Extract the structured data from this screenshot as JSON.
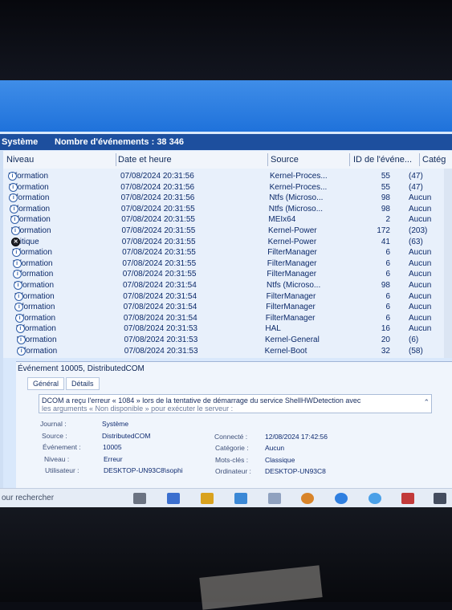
{
  "header": {
    "title": "Système",
    "event_count": "Nombre d'événements : 38 346"
  },
  "columns": {
    "niveau": "Niveau",
    "date": "Date et heure",
    "source": "Source",
    "id": "ID de l'événe...",
    "category": "Catég"
  },
  "rows": [
    {
      "level": "Information",
      "date": "07/08/2024 20:31:56",
      "source": "Kernel-Proces...",
      "id": "55",
      "category": "(47)"
    },
    {
      "level": "Information",
      "date": "07/08/2024 20:31:56",
      "source": "Kernel-Proces...",
      "id": "55",
      "category": "(47)"
    },
    {
      "level": "Information",
      "date": "07/08/2024 20:31:56",
      "source": "Ntfs (Microso...",
      "id": "98",
      "category": "Aucun"
    },
    {
      "level": "Information",
      "date": "07/08/2024 20:31:55",
      "source": "Ntfs (Microso...",
      "id": "98",
      "category": "Aucun"
    },
    {
      "level": "Information",
      "date": "07/08/2024 20:31:55",
      "source": "MEIx64",
      "id": "2",
      "category": "Aucun"
    },
    {
      "level": "Information",
      "date": "07/08/2024 20:31:55",
      "source": "Kernel-Power",
      "id": "172",
      "category": "(203)"
    },
    {
      "level": "Critique",
      "date": "07/08/2024 20:31:55",
      "source": "Kernel-Power",
      "id": "41",
      "category": "(63)"
    },
    {
      "level": "Information",
      "date": "07/08/2024 20:31:55",
      "source": "FilterManager",
      "id": "6",
      "category": "Aucun"
    },
    {
      "level": "Information",
      "date": "07/08/2024 20:31:55",
      "source": "FilterManager",
      "id": "6",
      "category": "Aucun"
    },
    {
      "level": "Information",
      "date": "07/08/2024 20:31:55",
      "source": "FilterManager",
      "id": "6",
      "category": "Aucun"
    },
    {
      "level": "Information",
      "date": "07/08/2024 20:31:54",
      "source": "Ntfs (Microso...",
      "id": "98",
      "category": "Aucun"
    },
    {
      "level": "Information",
      "date": "07/08/2024 20:31:54",
      "source": "FilterManager",
      "id": "6",
      "category": "Aucun"
    },
    {
      "level": "Information",
      "date": "07/08/2024 20:31:54",
      "source": "FilterManager",
      "id": "6",
      "category": "Aucun"
    },
    {
      "level": "Information",
      "date": "07/08/2024 20:31:54",
      "source": "FilterManager",
      "id": "6",
      "category": "Aucun"
    },
    {
      "level": "Information",
      "date": "07/08/2024 20:31:53",
      "source": "HAL",
      "id": "16",
      "category": "Aucun"
    },
    {
      "level": "Information",
      "date": "07/08/2024 20:31:53",
      "source": "Kernel-General",
      "id": "20",
      "category": "(6)"
    },
    {
      "level": "Information",
      "date": "07/08/2024 20:31:53",
      "source": "Kernel-Boot",
      "id": "32",
      "category": "(58)"
    }
  ],
  "detail": {
    "title": "Événement 10005, DistributedCOM",
    "tab_general": "Général",
    "tab_details": "Détails",
    "message_line1": "DCOM a reçu l'erreur « 1084 » lors de la tentative de démarrage du service ShellHWDetection avec",
    "message_line2": "les arguments « Non disponible » pour exécuter le serveur :",
    "journal_label": "Journal :",
    "journal_value": "Système",
    "source_label": "Source :",
    "source_value": "DistributedCOM",
    "event_label": "Événement :",
    "event_value": "10005",
    "niveau_label": "Niveau :",
    "niveau_value": "Erreur",
    "user_label": "Utilisateur :",
    "user_value": "DESKTOP-UN93C8\\sophi",
    "connected_label": "Connecté :",
    "connected_value": "12/08/2024 17:42:56",
    "category_label": "Catégorie :",
    "category_value": "Aucun",
    "keywords_label": "Mots-clés :",
    "keywords_value": "Classique",
    "computer_label": "Ordinateur :",
    "computer_value": "DESKTOP-UN93C8"
  },
  "taskbar": {
    "search_text": "our rechercher"
  },
  "colors": {
    "header_bg": "#1d4f9e",
    "list_text": "#0c2a6a",
    "critical_icon": "#22242a"
  }
}
